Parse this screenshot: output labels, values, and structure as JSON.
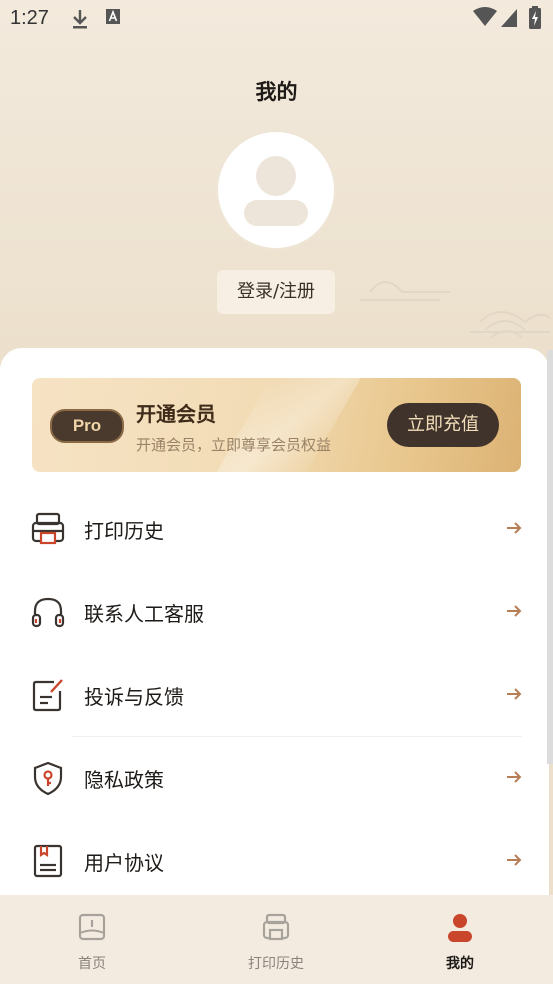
{
  "status_bar": {
    "time": "1:27"
  },
  "header": {
    "title": "我的"
  },
  "profile": {
    "login_label": "登录/注册"
  },
  "vip": {
    "badge": "Pro",
    "title": "开通会员",
    "subtitle": "开通会员，立即尊享会员权益",
    "button_label": "立即充值"
  },
  "menu": {
    "items": [
      {
        "label": "打印历史",
        "icon": "printer-icon"
      },
      {
        "label": "联系人工客服",
        "icon": "headset-icon"
      },
      {
        "label": "投诉与反馈",
        "icon": "feedback-edit-icon"
      },
      {
        "label": "隐私政策",
        "icon": "shield-key-icon"
      },
      {
        "label": "用户协议",
        "icon": "agreement-book-icon"
      }
    ]
  },
  "tabbar": {
    "tabs": [
      {
        "label": "首页",
        "icon": "home-book-icon",
        "active": false
      },
      {
        "label": "打印历史",
        "icon": "printer-icon",
        "active": false
      },
      {
        "label": "我的",
        "icon": "user-icon",
        "active": true
      }
    ]
  },
  "colors": {
    "accent": "#c9452b",
    "brown_dark": "#3f332b",
    "gold": "#dcb274",
    "arrow": "#b77d55"
  }
}
